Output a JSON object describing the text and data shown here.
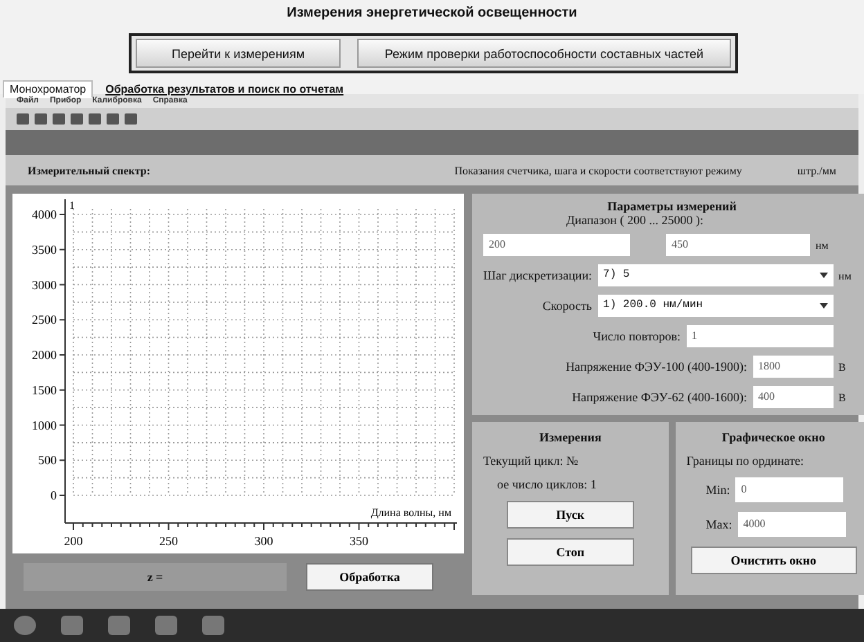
{
  "window": {
    "title": "Измерения энергетической освещенности"
  },
  "mode_buttons": [
    "Перейти к измерениям",
    "Режим проверки работоспособности составных частей"
  ],
  "tabs": [
    {
      "label": "Монохроматор",
      "selected": true
    },
    {
      "label": "Обработка результатов и поиск по отчетам",
      "selected": false
    }
  ],
  "menu": [
    "Файл",
    "Прибор",
    "Калибровка",
    "Справка"
  ],
  "spectrum_bar": {
    "label": "Измерительный спектр:",
    "status": "Показания счетчика, шага и скорости соответствуют режиму",
    "unit": "штр./мм"
  },
  "chart": {
    "chart_data": {
      "type": "line",
      "grid": true,
      "ylabel": "1",
      "xlabel": "Длина волны, нм",
      "xlim": [
        200,
        400
      ],
      "ylim": [
        0,
        4000
      ],
      "xticks": [
        200,
        250,
        300,
        350
      ],
      "yticks": [
        0,
        500,
        1000,
        1500,
        2000,
        2500,
        3000,
        3500,
        4000
      ]
    }
  },
  "result": {
    "label": "z =",
    "button": "Обработка"
  },
  "parameters": {
    "title": "Параметры измерений",
    "range_label": "Диапазон ( 200 ... 25000 ):",
    "range_from": "200",
    "range_to": "450",
    "range_unit": "нм",
    "rows": [
      {
        "kind": "select",
        "label": "Шаг дискретизации:",
        "value": "7)  5",
        "unit": "нм"
      },
      {
        "kind": "select",
        "label": "Скорость",
        "value": "1)  200.0 нм/мин"
      },
      {
        "kind": "input",
        "label": "Число повторов:",
        "value": "1"
      },
      {
        "kind": "input",
        "label": "Напряжение ФЭУ-100 (400-1900):",
        "value": "1800",
        "unit": "В"
      },
      {
        "kind": "input",
        "label": "Напряжение ФЭУ-62 (400-1600):",
        "value": "400",
        "unit": "В"
      }
    ]
  },
  "measurement": {
    "title": "Измерения",
    "current_cycle": "Текущий цикл: №",
    "total_cycles": "ое число циклов: 1",
    "buttons": [
      "Пуск",
      "Стоп"
    ]
  },
  "graph_window": {
    "title": "Графическое окно",
    "bounds_label": "Границы по ординате:",
    "min_label": "Min:",
    "min": "0",
    "max_label": "Max:",
    "max": "4000",
    "clear_button": "Очистить окно"
  }
}
